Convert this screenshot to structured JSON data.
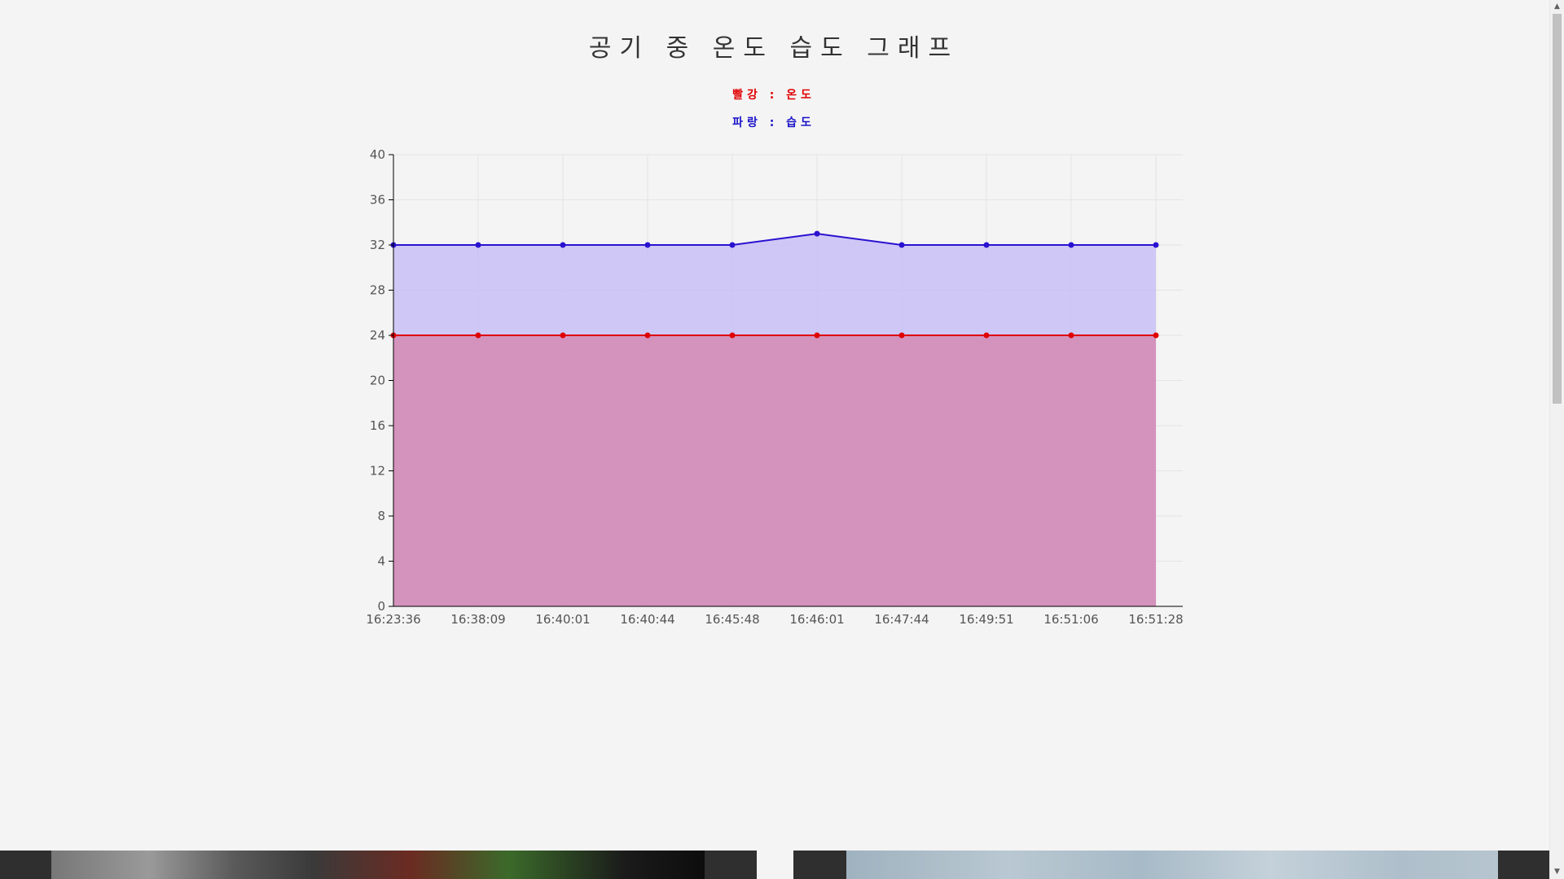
{
  "page": {
    "title": "공기 중 온도 습도 그래프",
    "legend_temperature": "빨강 : 온도",
    "legend_humidity": "파랑 : 습도"
  },
  "colors": {
    "temperature_line": "#e00000",
    "temperature_fill": "rgba(214, 130, 170, 0.75)",
    "humidity_line": "#2a12d0",
    "humidity_fill": "rgba(200, 190, 245, 0.85)",
    "background": "#f4f4f4"
  },
  "chart_data": {
    "type": "area",
    "x": [
      "16:23:36",
      "16:38:09",
      "16:40:01",
      "16:40:44",
      "16:45:48",
      "16:46:01",
      "16:47:44",
      "16:49:51",
      "16:51:06",
      "16:51:28"
    ],
    "series": [
      {
        "name": "온도",
        "values": [
          24,
          24,
          24,
          24,
          24,
          24,
          24,
          24,
          24,
          24
        ]
      },
      {
        "name": "습도",
        "values": [
          32,
          32,
          32,
          32,
          32,
          33,
          32,
          32,
          32,
          32
        ]
      }
    ],
    "ylim": [
      0,
      40
    ],
    "yticks": [
      0,
      4,
      8,
      12,
      16,
      20,
      24,
      28,
      32,
      36,
      40
    ],
    "grid": true
  },
  "cards": [
    {
      "icon": "photo-thumbnail-icon"
    },
    {
      "icon": "photo-thumbnail-icon"
    }
  ]
}
